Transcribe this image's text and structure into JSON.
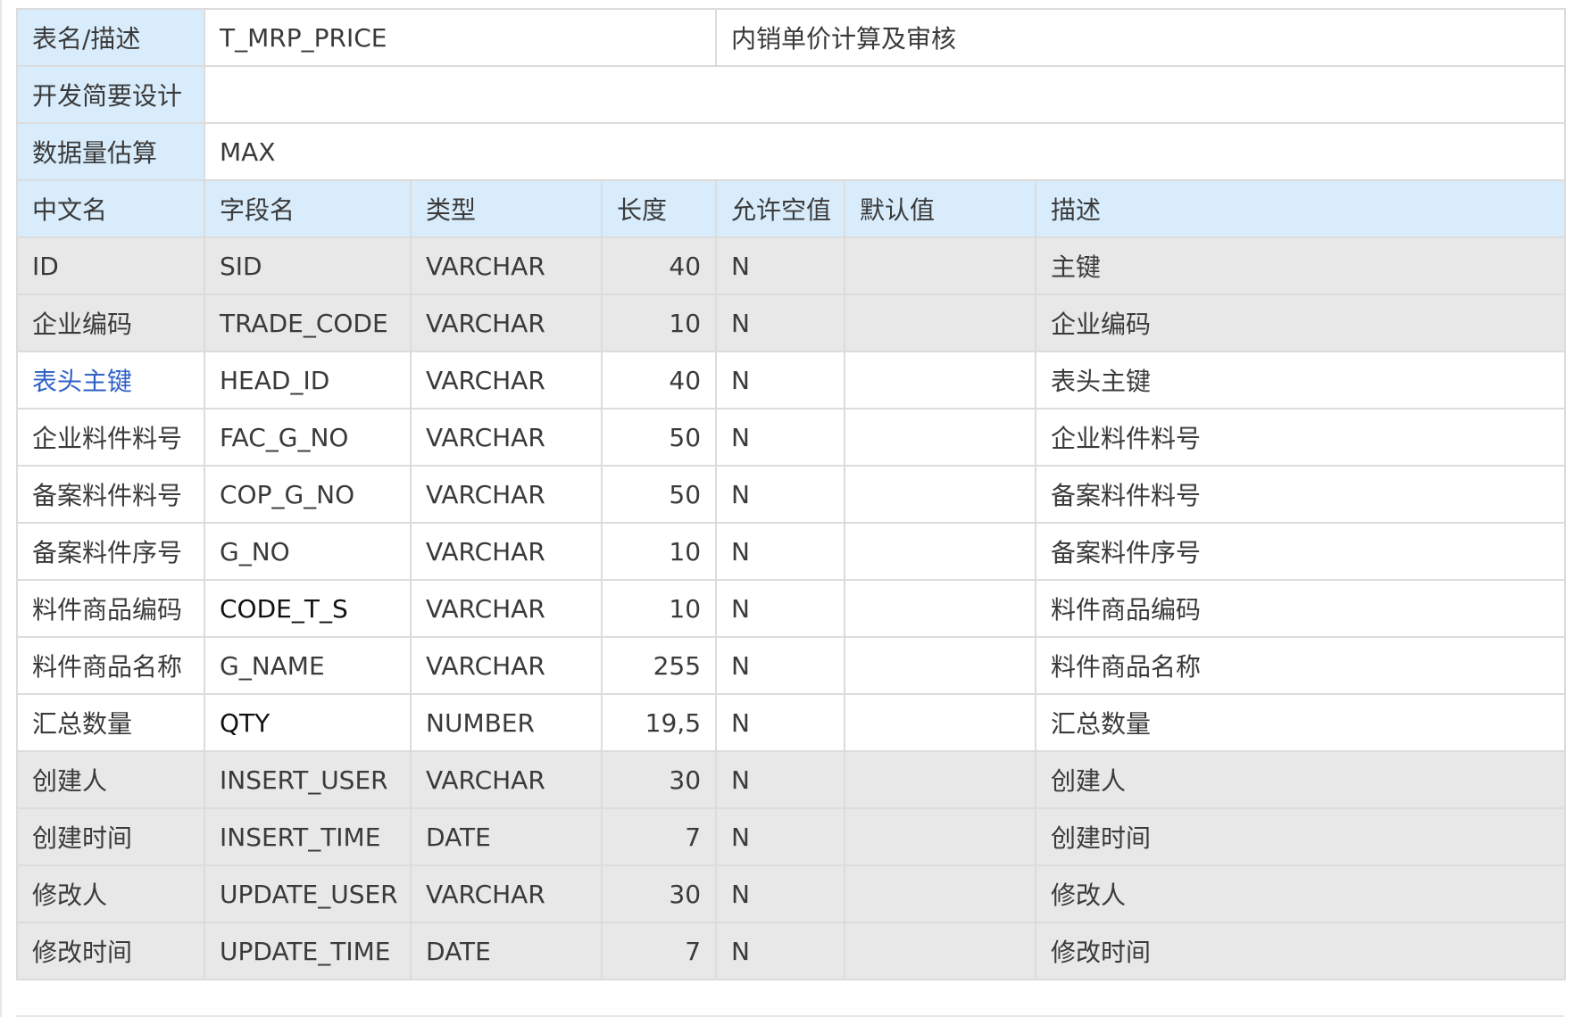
{
  "meta": {
    "table_label": "表名/描述",
    "table_name": "T_MRP_PRICE",
    "table_desc": "内销单价计算及审核",
    "design_label": "开发简要设计",
    "design_value": "",
    "volume_label": "数据量估算",
    "volume_value": "MAX"
  },
  "columns": [
    "中文名",
    "字段名",
    "类型",
    "长度",
    "允许空值",
    "默认值",
    "描述"
  ],
  "rows": [
    {
      "cn": "ID",
      "field": "SID",
      "type": "VARCHAR",
      "length": "40",
      "nullable": "N",
      "default": "",
      "desc": "主键",
      "shaded": true
    },
    {
      "cn": "企业编码",
      "field": "TRADE_CODE",
      "type": "VARCHAR",
      "length": "10",
      "nullable": "N",
      "default": "",
      "desc": "企业编码",
      "shaded": true
    },
    {
      "cn": "表头主键",
      "field": "HEAD_ID",
      "type": "VARCHAR",
      "length": "40",
      "nullable": "N",
      "default": "",
      "desc": "表头主键",
      "shaded": false,
      "link": true
    },
    {
      "cn": "企业料件料号",
      "field": "FAC_G_NO",
      "type": "VARCHAR",
      "length": "50",
      "nullable": "N",
      "default": "",
      "desc": "企业料件料号",
      "shaded": false
    },
    {
      "cn": "备案料件料号",
      "field": "COP_G_NO",
      "type": "VARCHAR",
      "length": "50",
      "nullable": "N",
      "default": "",
      "desc": "备案料件料号",
      "shaded": false
    },
    {
      "cn": "备案料件序号",
      "field": "G_NO",
      "type": "VARCHAR",
      "length": "10",
      "nullable": "N",
      "default": "",
      "desc": "备案料件序号",
      "shaded": false
    },
    {
      "cn": "料件商品编码",
      "field": "CODE_T_S",
      "type": "VARCHAR",
      "length": "10",
      "nullable": "N",
      "default": "",
      "desc": "料件商品编码",
      "shaded": false,
      "dark_field": true
    },
    {
      "cn": "料件商品名称",
      "field": "G_NAME",
      "type": "VARCHAR",
      "length": "255",
      "nullable": "N",
      "default": "",
      "desc": "料件商品名称",
      "shaded": false
    },
    {
      "cn": "汇总数量",
      "field": "QTY",
      "type": "NUMBER",
      "length": "19,5",
      "nullable": "N",
      "default": "",
      "desc": "汇总数量",
      "shaded": false,
      "dark_field": true
    },
    {
      "cn": "创建人",
      "field": "INSERT_USER",
      "type": "VARCHAR",
      "length": "30",
      "nullable": "N",
      "default": "",
      "desc": "创建人",
      "shaded": true
    },
    {
      "cn": "创建时间",
      "field": "INSERT_TIME",
      "type": "DATE",
      "length": "7",
      "nullable": "N",
      "default": "",
      "desc": "创建时间",
      "shaded": true
    },
    {
      "cn": "修改人",
      "field": "UPDATE_USER",
      "type": "VARCHAR",
      "length": "30",
      "nullable": "N",
      "default": "",
      "desc": "修改人",
      "shaded": true
    },
    {
      "cn": "修改时间",
      "field": "UPDATE_TIME",
      "type": "DATE",
      "length": "7",
      "nullable": "N",
      "default": "",
      "desc": "修改时间",
      "shaded": true
    }
  ],
  "colors": {
    "label_bg": "#d9ecfb",
    "shaded_row_bg": "#e8e8e8",
    "link_text": "#2f61c7",
    "border": "#dcdcdc"
  }
}
